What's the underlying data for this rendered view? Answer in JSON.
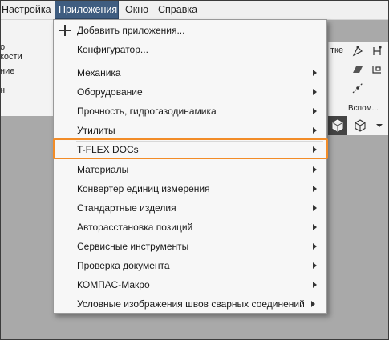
{
  "menubar": {
    "items": [
      {
        "label": "Настройка"
      },
      {
        "label": "Приложения"
      },
      {
        "label": "Окно"
      },
      {
        "label": "Справка"
      }
    ]
  },
  "ribbon_left": {
    "lines": [
      "о",
      "кости",
      "ние",
      "н"
    ]
  },
  "ribbon_right": {
    "label_top": "тке",
    "label_bottom": "Вспом..."
  },
  "dropdown": {
    "add_app": "Добавить приложения...",
    "configurator": "Конфигуратор...",
    "items": [
      {
        "label": "Механика"
      },
      {
        "label": "Оборудование"
      },
      {
        "label": "Прочность, гидрогазодинамика"
      },
      {
        "label": "Утилиты"
      },
      {
        "label": "T-FLEX DOCs"
      },
      {
        "label": "Материалы"
      },
      {
        "label": "Конвертер единиц измерения"
      },
      {
        "label": "Стандартные изделия"
      },
      {
        "label": "Авторасстановка позиций"
      },
      {
        "label": "Сервисные инструменты"
      },
      {
        "label": "Проверка документа"
      },
      {
        "label": "КОМПАС-Макро"
      },
      {
        "label": "Условные изображения швов сварных соединений"
      }
    ]
  },
  "colors": {
    "active_menu": "#3f5d80",
    "highlight": "#f28c28"
  }
}
